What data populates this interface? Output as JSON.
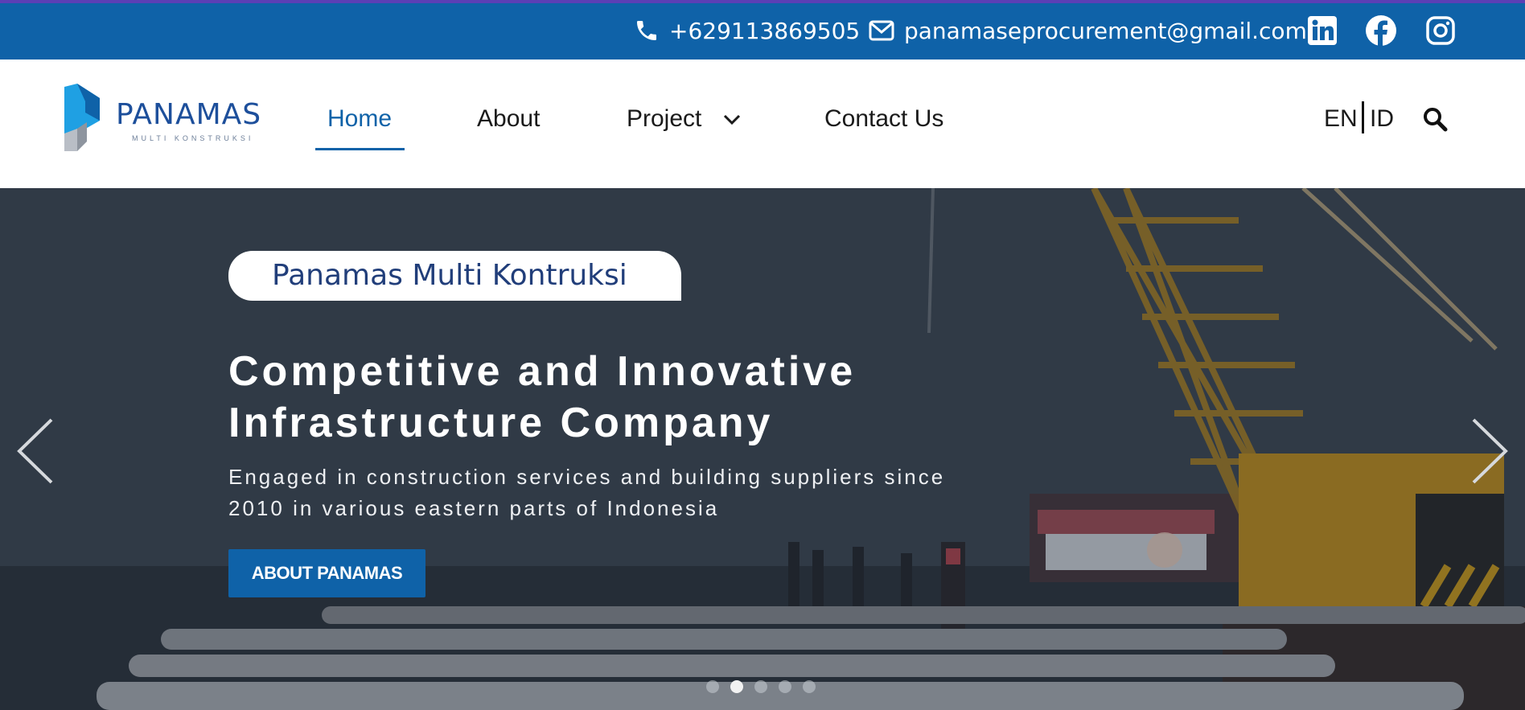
{
  "topbar": {
    "phone": "+629113869505",
    "email": "panamaseprocurement@gmail.com",
    "social": [
      "linkedin-icon",
      "facebook-icon",
      "instagram-icon"
    ],
    "bar_color": "#0f62a8"
  },
  "header": {
    "logo_text": "PANAMAS",
    "logo_subtext": "MULTI KONSTRUKSI",
    "nav": {
      "home": "Home",
      "about": "About",
      "project": "Project",
      "contact": "Contact Us"
    },
    "active_nav": "Home",
    "lang_en": "EN",
    "lang_id": "ID",
    "accent_color": "#0f62a8"
  },
  "hero": {
    "badge": "Panamas Multi Kontruksi",
    "headline_line1": "Competitive and Innovative",
    "headline_line2": "Infrastructure Company",
    "subtitle_line1": "Engaged in construction services and building suppliers since",
    "subtitle_line2": "2010 in various eastern parts of Indonesia",
    "cta": "ABOUT PANAMAS",
    "slide_count": 5,
    "active_slide": 2
  }
}
